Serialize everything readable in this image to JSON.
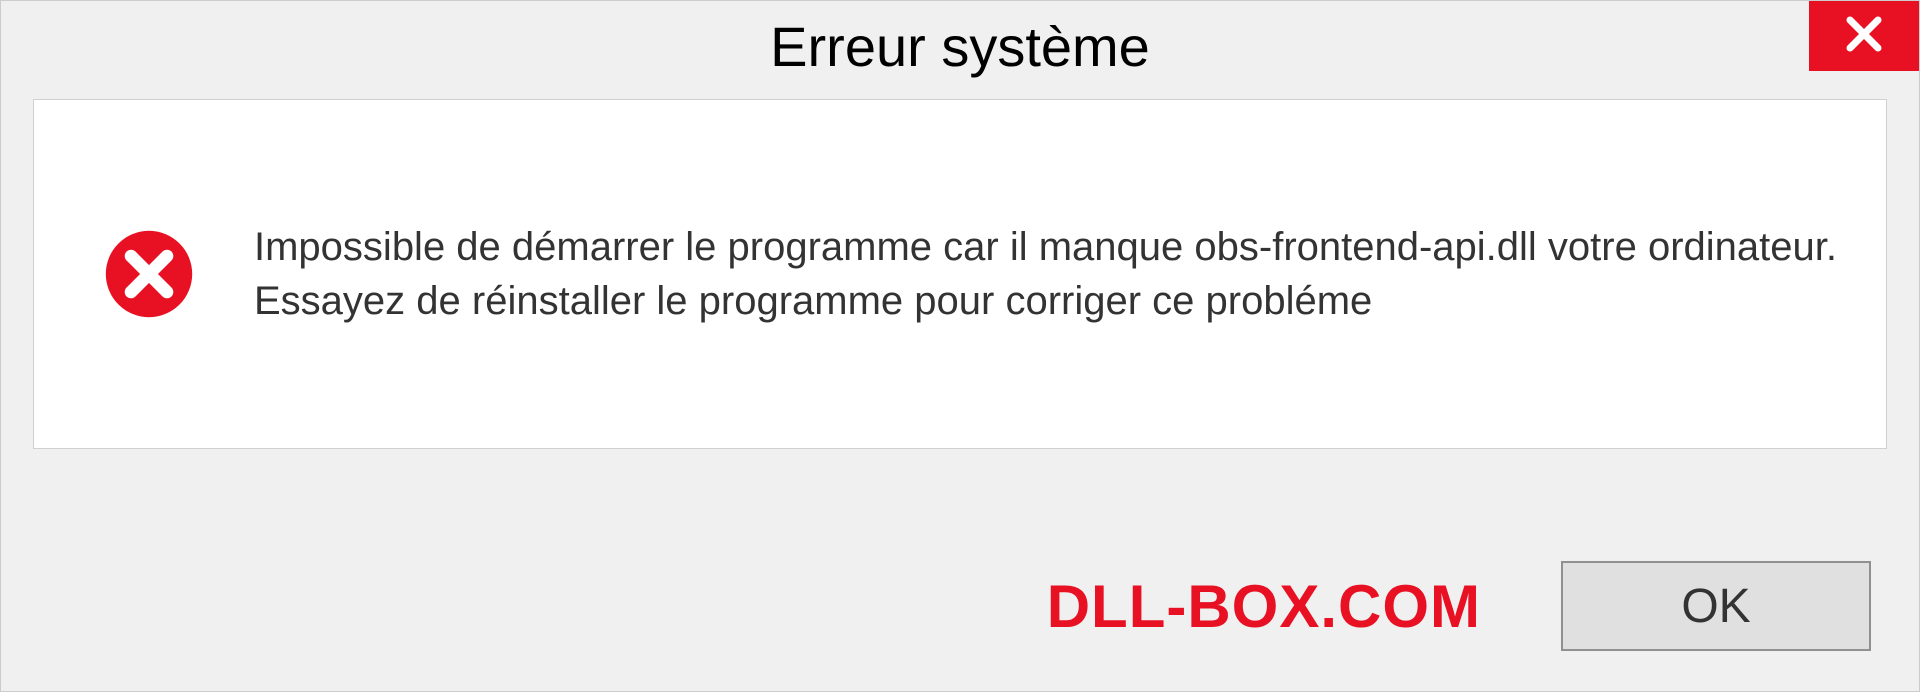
{
  "dialog": {
    "title": "Erreur système",
    "message": "Impossible de démarrer le programme car il manque obs-frontend-api.dll votre ordinateur. Essayez de réinstaller le programme pour corriger ce probléme",
    "ok_label": "OK"
  },
  "watermark": "DLL-BOX.COM",
  "colors": {
    "error_red": "#e81123",
    "background": "#f0f0f0",
    "content_bg": "#ffffff"
  }
}
